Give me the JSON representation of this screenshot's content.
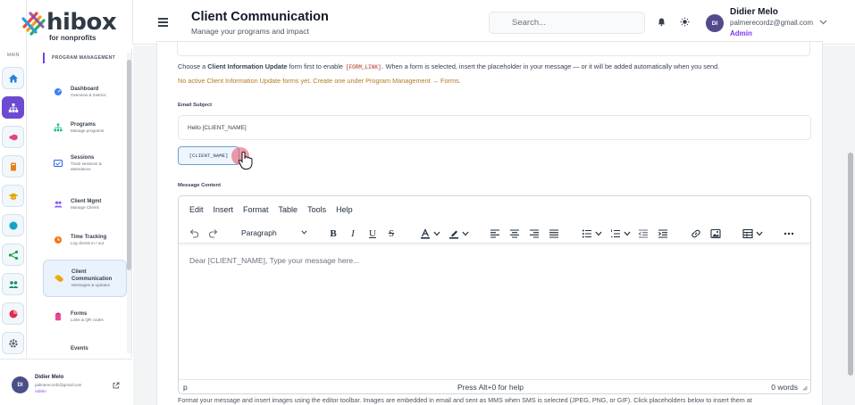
{
  "brand": {
    "name": "hibox",
    "tagline": "for nonprofits"
  },
  "rail": {
    "main_label": "MAIN",
    "icons": [
      "home-icon",
      "org-chart-icon",
      "megaphone-icon",
      "book-icon",
      "graduation-icon",
      "globe-icon",
      "share-icon",
      "group-icon",
      "pie-chart-icon",
      "gear-icon"
    ]
  },
  "sidebar": {
    "section": "PROGRAM MANAGEMENT",
    "items": [
      {
        "title": "Dashboard",
        "desc": "Overview & metrics",
        "icon": "speedometer-icon",
        "color": "#3b82f6"
      },
      {
        "title": "Programs",
        "desc": "Manage programs",
        "icon": "org-chart-icon",
        "color": "#10b981"
      },
      {
        "title": "Sessions",
        "desc": "Track sessions &",
        "desc2": "attendance",
        "icon": "calendar-icon",
        "color": "#2563eb"
      },
      {
        "title": "Client Mgmt",
        "desc": "Manage Clients",
        "icon": "users-icon",
        "color": "#8b5cf6"
      },
      {
        "title": "Time Tracking",
        "desc": "Log clients in / out",
        "icon": "clock-icon",
        "color": "#f97316"
      },
      {
        "title": "Client",
        "title2": "Communication",
        "desc": "Messages & updates",
        "icon": "chat-icon",
        "color": "#eab308"
      },
      {
        "title": "Forms",
        "desc": "Links & QR codes",
        "icon": "clipboard-icon",
        "color": "#ec4899"
      },
      {
        "title": "Events",
        "desc": "",
        "icon": "",
        "color": "#6b7280"
      }
    ]
  },
  "user": {
    "initials": "DI",
    "name": "Didier Melo",
    "email": "palmerecordz@gmail.com",
    "role": "Admin"
  },
  "header": {
    "title": "Client Communication",
    "subtitle": "Manage your programs and impact",
    "search_placeholder": "Search..."
  },
  "form": {
    "help_prefix": "Choose a ",
    "help_bold": "Client Information Update",
    "help_mid": " form first to enable ",
    "help_code": "[FORM_LINK]",
    "help_suffix": ". When a form is selected, insert the placeholder in your message — or it will be added automatically when you send.",
    "warning": "No active Client Information Update forms yet. Create one under Program Management → Forms.",
    "subject_label": "Email Subject",
    "subject_value": "Hello [CLIENT_NAME]",
    "placeholder_button": "[CLIENT_NAME]",
    "message_label": "Message Content"
  },
  "editor": {
    "menu": [
      "Edit",
      "Insert",
      "Format",
      "Table",
      "Tools",
      "Help"
    ],
    "block_format": "Paragraph",
    "content": "Dear [CLIENT_NAME], Type your message here...",
    "status_path": "p",
    "status_help": "Press Alt+0 for help",
    "word_count": "0 words"
  },
  "footnote": "Format your message and insert images using the editor toolbar. Images are embedded in email and sent as MMS when SMS is selected (JPEG, PNG, or GIF). Click placeholders below to insert them at"
}
